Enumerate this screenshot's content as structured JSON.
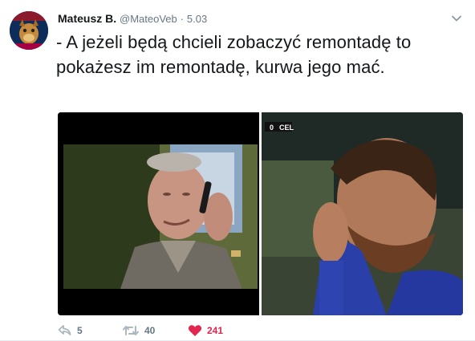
{
  "tweet": {
    "author_name": "Mateusz B.",
    "handle": "@MateoVeb",
    "separator": "·",
    "time": "5.03",
    "text": "- A jeżeli będą chcieli zobaczyć remontadę to pokażesz im remontadę, kurwa jego mać."
  },
  "media": {
    "scoreboard_score": "0",
    "scoreboard_team": "CEL"
  },
  "actions": {
    "reply_count": "5",
    "retweet_count": "40",
    "like_count": "241",
    "like_color": "#e2264d"
  },
  "icons": [
    "avatar",
    "chevron-down-icon",
    "reply-icon",
    "retweet-icon",
    "heart-icon"
  ]
}
